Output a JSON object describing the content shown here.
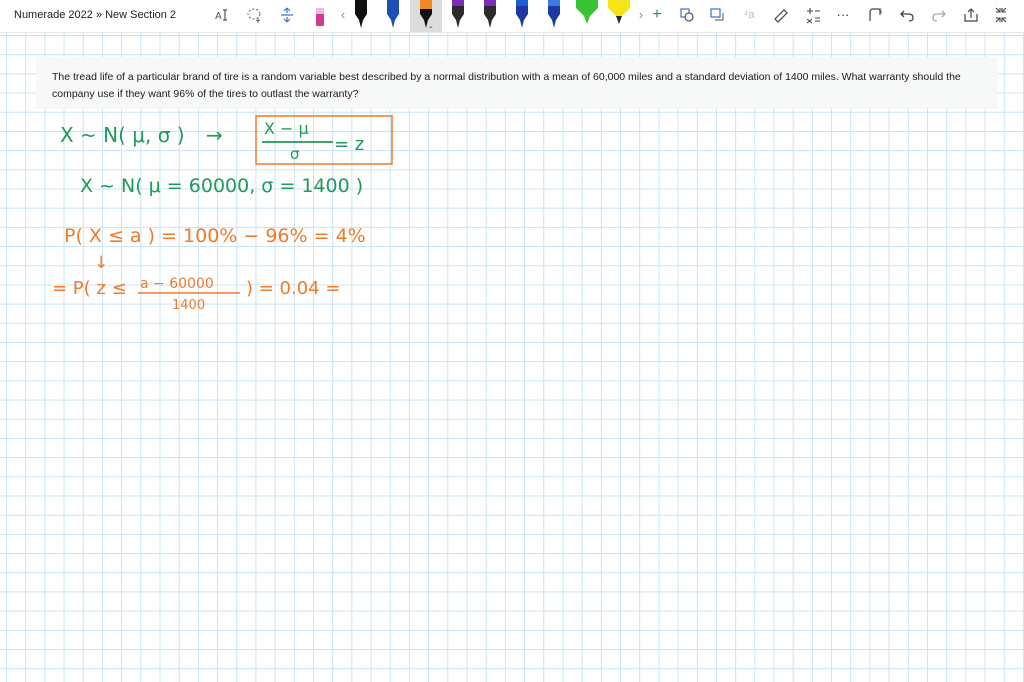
{
  "toolbar": {
    "breadcrumb": "Numerade 2022 » New Section 2",
    "icons": [
      "text-cursor-icon",
      "lasso-icon",
      "space-icon",
      "eraser-icon",
      "chevron-left-icon",
      "pen-icon",
      "chevron-right-icon",
      "plus-icon",
      "shapes-icon",
      "ink-to-shape-icon",
      "ink-to-text-icon",
      "ruler-icon",
      "math-icon",
      "more-icon",
      "replay-icon",
      "undo-icon",
      "redo-icon",
      "share-icon",
      "collapse-icon"
    ],
    "pen_colors": [
      "#111111",
      "#1f4fb4",
      "#f08a24",
      "#2b2b2b",
      "#7b2fb5",
      "#1d5fd0",
      "#1a3aa0",
      "#3c7ae0",
      "#23a34a",
      "#39c234",
      "#f3e51a"
    ],
    "more_label": "···"
  },
  "question": {
    "text": "The tread life of a particular brand of tire is a random variable best described by a normal distribution with a mean of 60,000 miles and a standard deviation of 1400 miles. What warranty should the company use if they want 96% of the tires to outlast the warranty?"
  },
  "handwriting": {
    "colors": {
      "green": "#1f9a5a",
      "orange": "#f07a2a"
    },
    "line1_left": "X ~ N( μ, σ )",
    "line1_arrow": "→",
    "line1_frac_num": "X − μ",
    "line1_frac_den": "σ",
    "line1_right": "= z",
    "line2": "X ~ N( μ = 60000,  σ = 1400 )",
    "line3": "P( X ≤ a ) = 100% − 96% = 4%",
    "line4_arrow": "↓",
    "line5_left": "= P( z ≤",
    "line5_frac_num": "a − 60000",
    "line5_frac_den": "1400",
    "line5_right": ") = 0.04 ="
  }
}
